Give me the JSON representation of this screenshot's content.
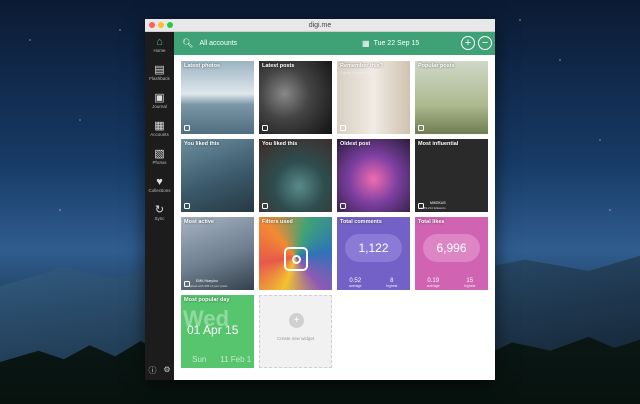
{
  "window": {
    "title": "digi.me"
  },
  "sidebar": {
    "items": [
      {
        "label": "Home"
      },
      {
        "label": "Flashback"
      },
      {
        "label": "Journal"
      },
      {
        "label": "Accounts"
      },
      {
        "label": "Photos"
      },
      {
        "label": "Collections"
      },
      {
        "label": "Sync"
      }
    ]
  },
  "topbar": {
    "filter_label": "All accounts",
    "date": "Tue 22 Sep 15",
    "add_symbol": "+",
    "remove_symbol": "−"
  },
  "tiles": {
    "latest_photos": {
      "label": "Latest photos"
    },
    "latest_posts": {
      "label": "Latest posts"
    },
    "remember": {
      "label": "Remember this?",
      "sub": "1 year 3 years ago"
    },
    "popular_posts": {
      "label": "Popular posts"
    },
    "you_liked_1": {
      "label": "You liked this"
    },
    "you_liked_2": {
      "label": "You liked this"
    },
    "oldest_post": {
      "label": "Oldest post"
    },
    "most_influential": {
      "label": "Most influential",
      "name": "MIKEKUS",
      "sub": "has 59,214 followers"
    },
    "most_active": {
      "label": "Most active",
      "name": "EMILYdarylou",
      "sub": "Interacted with 265 of your posts"
    },
    "filters_used": {
      "label": "Filters used"
    },
    "total_comments": {
      "label": "Total comments",
      "value": "1,122",
      "stat1_value": "0.52",
      "stat1_caption": "average",
      "stat2_value": "8",
      "stat2_caption": "highest"
    },
    "total_likes": {
      "label": "Total likes",
      "value": "6,996",
      "stat1_value": "0.19",
      "stat1_caption": "average",
      "stat2_value": "15",
      "stat2_caption": "highest"
    },
    "most_popular_day": {
      "label": "Most popular day",
      "big": "Wed",
      "date": "01 Apr 15",
      "foot1": "Sun",
      "foot2": "11 Feb 1"
    },
    "create_widget": {
      "label": "Create new widget"
    }
  }
}
